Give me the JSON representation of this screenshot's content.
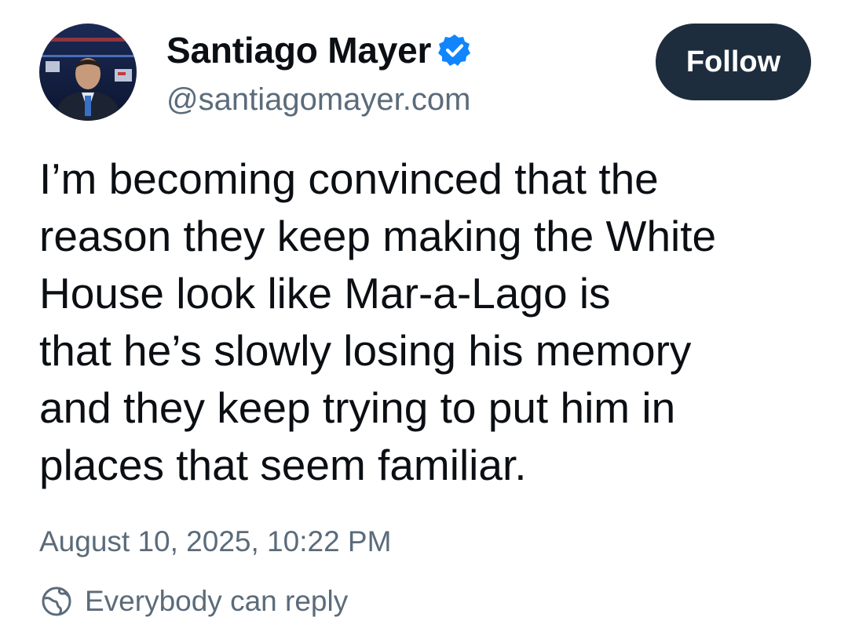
{
  "author": {
    "display_name": "Santiago Mayer",
    "handle": "@santiagomayer.com",
    "verified": true,
    "avatar_icon": "profile-photo"
  },
  "actions": {
    "follow_label": "Follow"
  },
  "post": {
    "lines": [
      "I’m becoming convinced that the",
      "reason they keep making the White",
      "House look like Mar-a-Lago is",
      "that he’s slowly losing his memory",
      "and they keep trying to put him in",
      "places that seem familiar."
    ],
    "timestamp": "August 10, 2025, 10:22 PM",
    "reply_setting": "Everybody can reply"
  },
  "colors": {
    "text": "#0b0f14",
    "muted": "#5b6b7a",
    "button_bg": "#1e2d3d",
    "verified": "#1185fe"
  }
}
